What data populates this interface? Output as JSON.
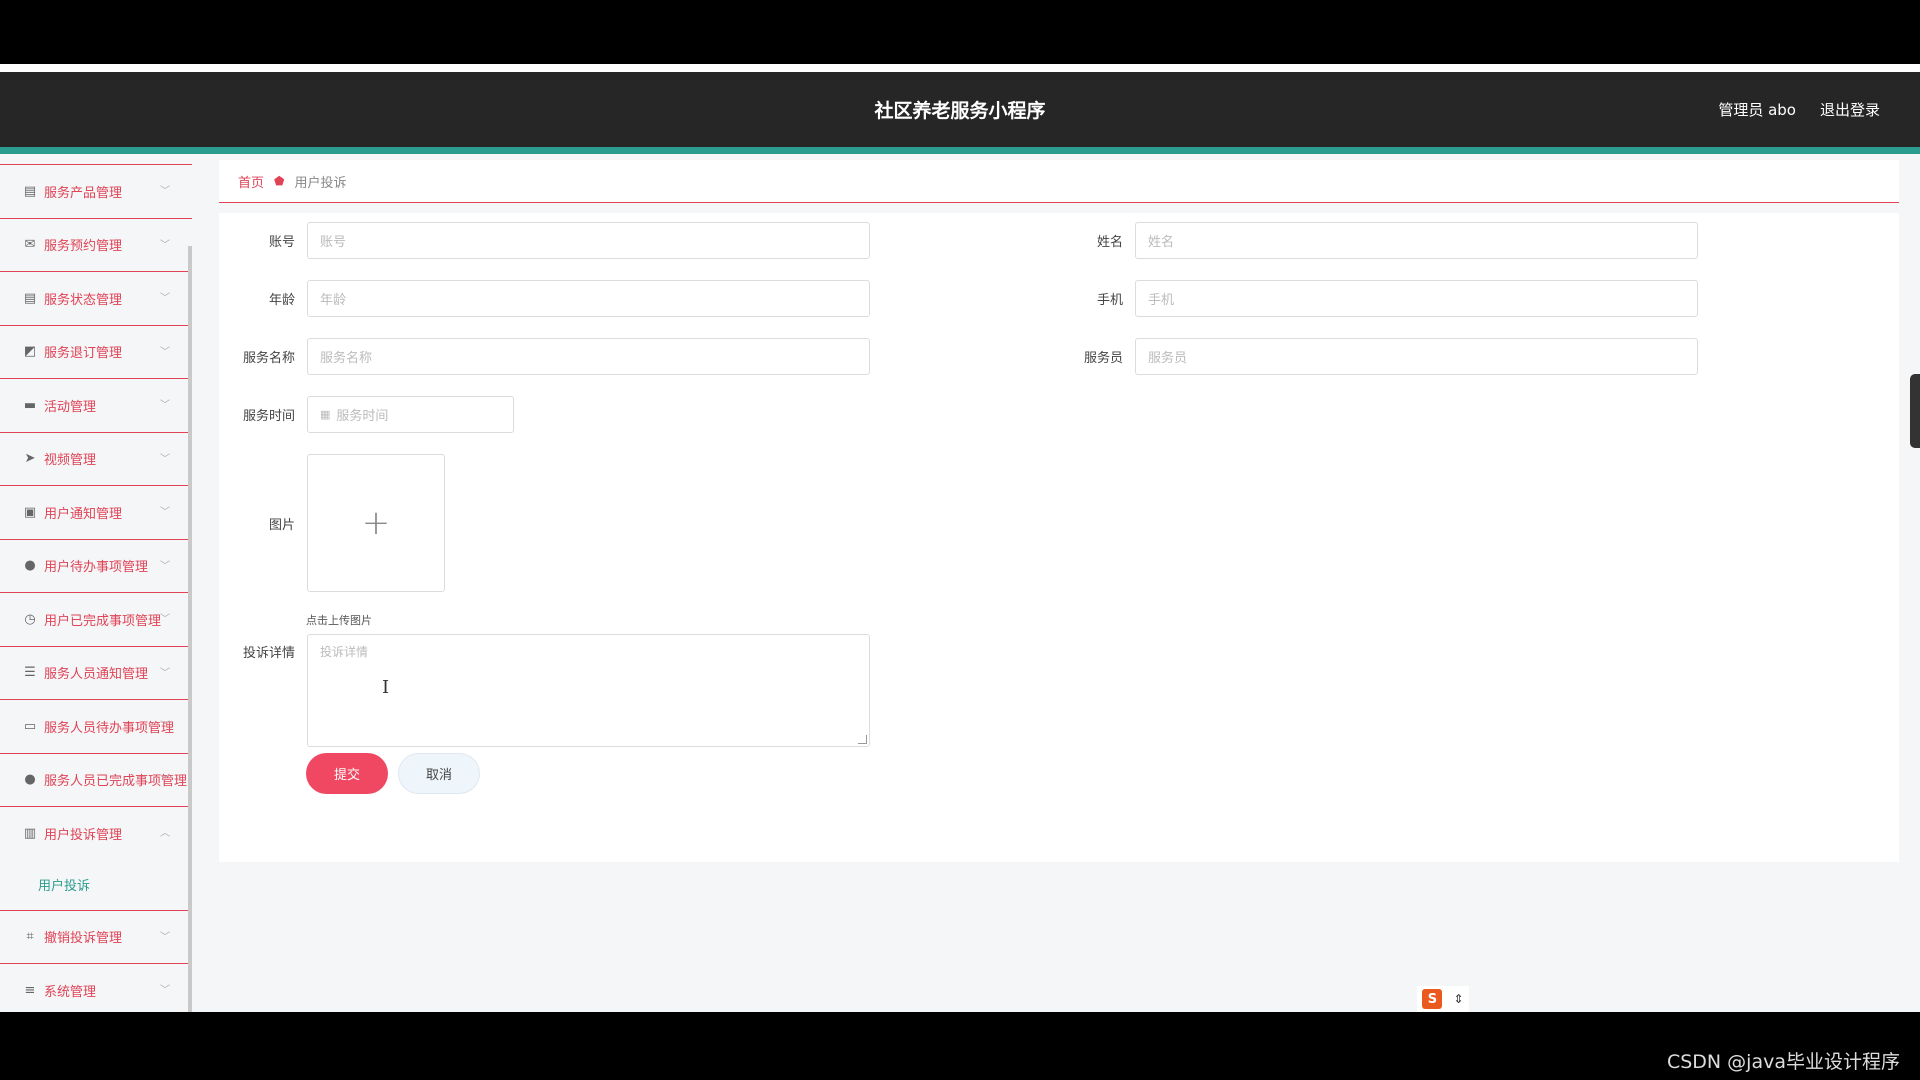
{
  "app": {
    "title": "社区养老服务小程序",
    "user_label": "管理员 abo",
    "logout_label": "退出登录"
  },
  "colors": {
    "accent_red": "#e04356",
    "teal": "#2a9d8f",
    "header_bg": "#262626",
    "submit_bg": "#f04862"
  },
  "sidebar": {
    "items": [
      {
        "label": "服务产品管理",
        "icon": "clipboard-icon",
        "glyph": "▤"
      },
      {
        "label": "服务预约管理",
        "icon": "mail-icon",
        "glyph": "✉"
      },
      {
        "label": "服务状态管理",
        "icon": "clipboard-icon",
        "glyph": "▤"
      },
      {
        "label": "服务退订管理",
        "icon": "chart-icon",
        "glyph": "◩"
      },
      {
        "label": "活动管理",
        "icon": "monitor-icon",
        "glyph": "▬"
      },
      {
        "label": "视频管理",
        "icon": "send-icon",
        "glyph": "➤"
      },
      {
        "label": "用户通知管理",
        "icon": "document-icon",
        "glyph": "▣"
      },
      {
        "label": "用户待办事项管理",
        "icon": "user-icon",
        "glyph": "●"
      },
      {
        "label": "用户已完成事项管理",
        "icon": "clock-icon",
        "glyph": "◷"
      },
      {
        "label": "服务人员通知管理",
        "icon": "list-icon",
        "glyph": "☰"
      },
      {
        "label": "服务人员待办事项管理",
        "icon": "message-icon",
        "glyph": "▭"
      },
      {
        "label": "服务人员已完成事项管理",
        "icon": "bulb-icon",
        "glyph": "●"
      },
      {
        "label": "用户投诉管理",
        "icon": "library-icon",
        "glyph": "▥"
      }
    ],
    "submenu": {
      "label": "用户投诉"
    },
    "items_after": [
      {
        "label": "撤销投诉管理",
        "icon": "crop-icon",
        "glyph": "⌗"
      },
      {
        "label": "系统管理",
        "icon": "sliders-icon",
        "glyph": "≡"
      }
    ]
  },
  "breadcrumb": {
    "home": "首页",
    "current": "用户投诉"
  },
  "form": {
    "account": {
      "label": "账号",
      "placeholder": "账号"
    },
    "name": {
      "label": "姓名",
      "placeholder": "姓名"
    },
    "age": {
      "label": "年龄",
      "placeholder": "年龄"
    },
    "phone": {
      "label": "手机",
      "placeholder": "手机"
    },
    "service_name": {
      "label": "服务名称",
      "placeholder": "服务名称"
    },
    "server": {
      "label": "服务员",
      "placeholder": "服务员"
    },
    "service_time": {
      "label": "服务时间",
      "placeholder": "服务时间"
    },
    "image": {
      "label": "图片",
      "upload_tip": "点击上传图片"
    },
    "detail": {
      "label": "投诉详情",
      "placeholder": "投诉详情"
    },
    "submit_label": "提交",
    "cancel_label": "取消"
  },
  "watermark": "CSDN @java毕业设计程序",
  "tray": {
    "ime": "S"
  }
}
